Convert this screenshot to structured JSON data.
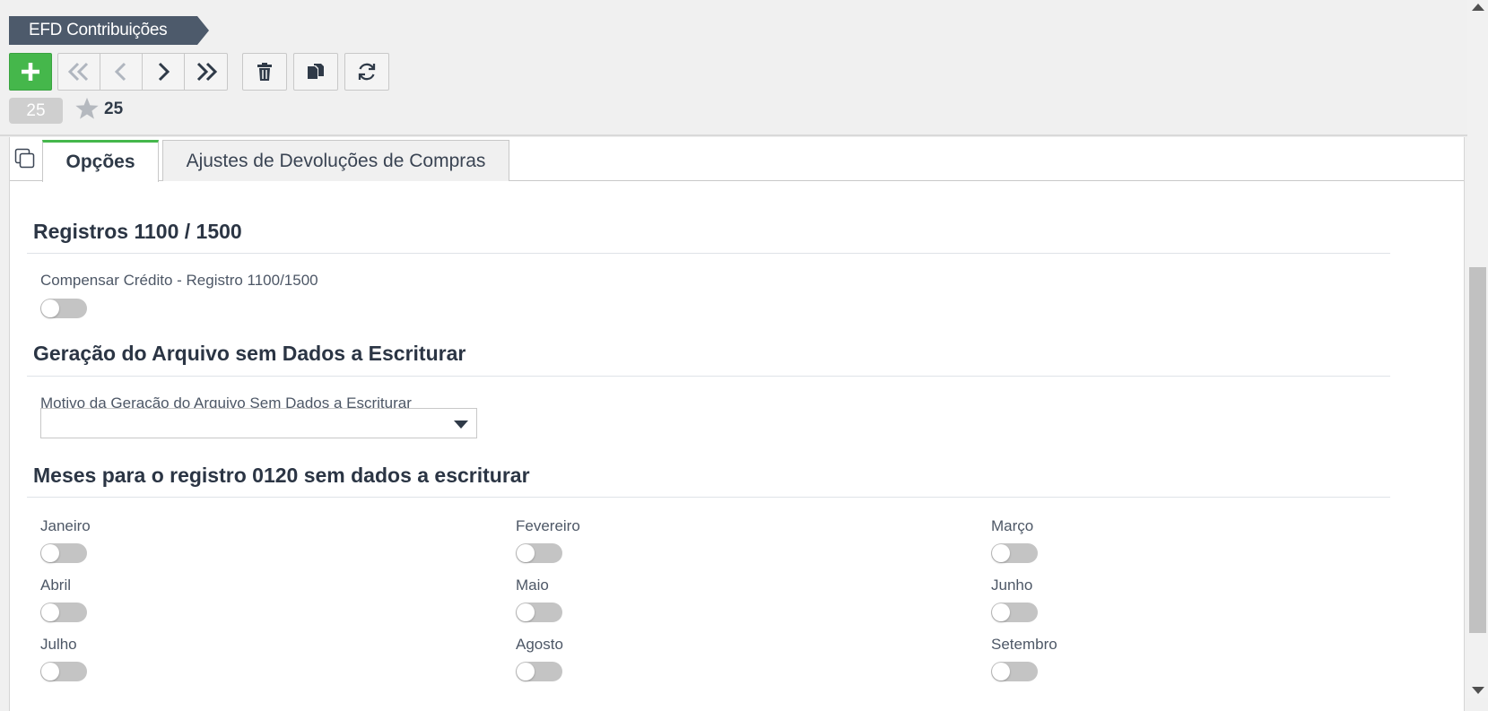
{
  "header": {
    "breadcrumb": "EFD Contribuições",
    "record_count": "25",
    "favorites_count": "25"
  },
  "toolbar": {
    "buttons": [
      {
        "name": "add",
        "icon": "plus-icon"
      },
      {
        "name": "first",
        "icon": "double-chevron-left-icon"
      },
      {
        "name": "previous",
        "icon": "chevron-left-icon"
      },
      {
        "name": "next",
        "icon": "chevron-right-icon"
      },
      {
        "name": "last",
        "icon": "double-chevron-right-icon"
      },
      {
        "name": "delete",
        "icon": "trash-icon"
      },
      {
        "name": "copy",
        "icon": "copy-icon"
      },
      {
        "name": "refresh",
        "icon": "refresh-icon"
      }
    ]
  },
  "tabs": [
    {
      "label": "Opções",
      "active": true
    },
    {
      "label": "Ajustes de Devoluções de Compras",
      "active": false
    }
  ],
  "sections": {
    "registros": {
      "title": "Registros 1100 / 1500",
      "compensar_label": "Compensar Crédito - Registro 1100/1500",
      "compensar_value": false
    },
    "geracao": {
      "title": "Geração do Arquivo sem Dados a Escriturar",
      "motivo_label": "Motivo da Geração do Arquivo Sem Dados a Escriturar",
      "motivo_value": ""
    },
    "meses": {
      "title": "Meses para o registro 0120 sem dados a escriturar",
      "months": [
        {
          "label": "Janeiro",
          "value": false
        },
        {
          "label": "Fevereiro",
          "value": false
        },
        {
          "label": "Março",
          "value": false
        },
        {
          "label": "Abril",
          "value": false
        },
        {
          "label": "Maio",
          "value": false
        },
        {
          "label": "Junho",
          "value": false
        },
        {
          "label": "Julho",
          "value": false
        },
        {
          "label": "Agosto",
          "value": false
        },
        {
          "label": "Setembro",
          "value": false
        }
      ]
    }
  },
  "colors": {
    "accent_green": "#45b74b",
    "breadcrumb_bg": "#4d5a6b",
    "toggle_off": "#c4c4c4"
  }
}
